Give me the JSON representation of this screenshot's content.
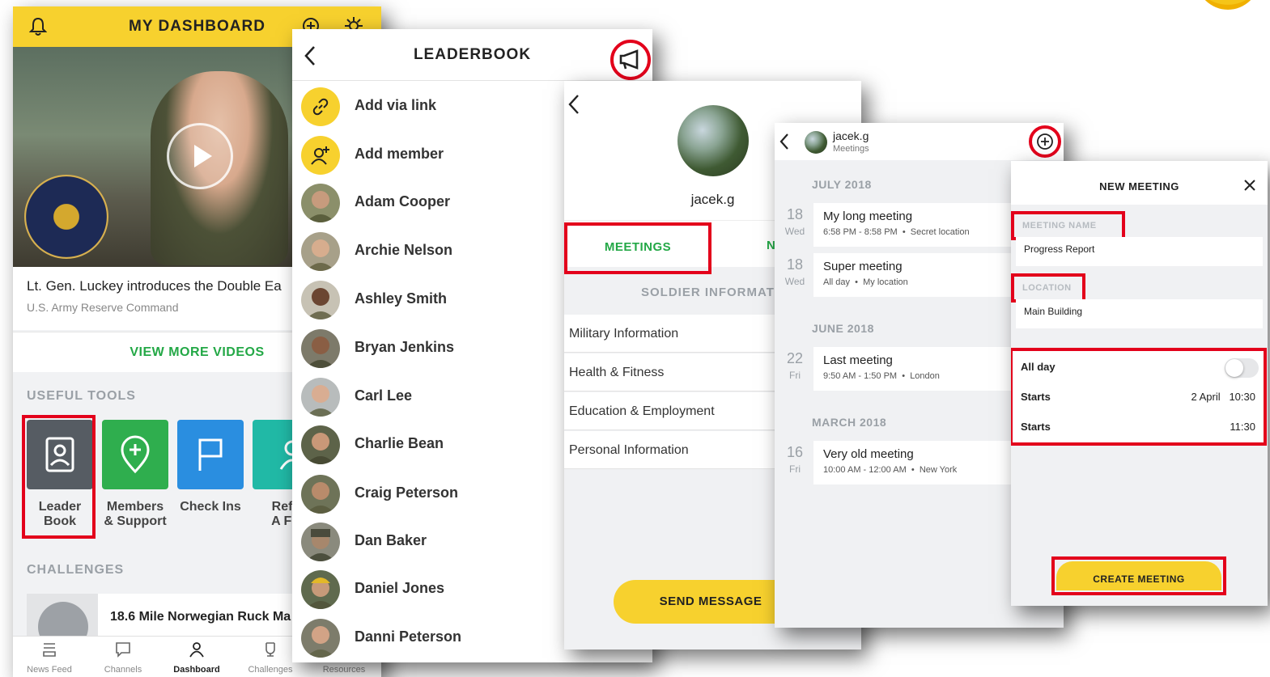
{
  "colors": {
    "yellow": "#f7d12e",
    "green": "#23a846",
    "highlight": "#e3001b"
  },
  "dashboard": {
    "title": "MY DASHBOARD",
    "video_title": "Lt. Gen. Luckey introduces the Double Ea",
    "video_source": "U.S. Army Reserve Command",
    "view_more": "VIEW MORE VIDEOS",
    "useful_tools_label": "USEFUL TOOLS",
    "tools": [
      {
        "line1": "Leader",
        "line2": "Book",
        "icon": "leaderbook-icon",
        "color": "#565c63"
      },
      {
        "line1": "Members",
        "line2": "& Support",
        "icon": "map-pin-plus-icon",
        "color": "#2fae4e"
      },
      {
        "line1": "Check Ins",
        "line2": "",
        "icon": "flag-icon",
        "color": "#2a8ee0"
      },
      {
        "line1": "Refe",
        "line2": "A Fri",
        "icon": "referral-icon",
        "color": "#21b9a6"
      }
    ],
    "challenges_label": "CHALLENGES",
    "challenge_title": "18.6 Mile Norwegian Ruck Ma",
    "nav": [
      {
        "label": "News Feed",
        "icon": "news-feed-icon"
      },
      {
        "label": "Channels",
        "icon": "channels-icon"
      },
      {
        "label": "Dashboard",
        "icon": "dashboard-icon"
      },
      {
        "label": "Challenges",
        "icon": "challenges-icon"
      },
      {
        "label": "Resources",
        "icon": "resources-icon"
      }
    ]
  },
  "leaderbook": {
    "title": "LEADERBOOK",
    "actions": [
      {
        "label": "Add via link",
        "icon": "link-icon"
      },
      {
        "label": "Add member",
        "icon": "add-person-icon"
      }
    ],
    "members": [
      "Adam Cooper",
      "Archie Nelson",
      "Ashley Smith",
      "Bryan Jenkins",
      "Carl Lee",
      "Charlie Bean",
      "Craig Peterson",
      "Dan Baker",
      "Daniel Jones",
      "Danni Peterson"
    ]
  },
  "profile": {
    "username": "jacek.g",
    "tab_meetings": "MEETINGS",
    "tab_next": "N",
    "section_title": "SOLDIER INFORMATIO",
    "items": [
      "Military Information",
      "Health & Fitness",
      "Education & Employment",
      "Personal Information"
    ],
    "send_message": "SEND MESSAGE"
  },
  "meetings": {
    "username": "jacek.g",
    "subtitle": "Meetings",
    "groups": [
      {
        "month": "JULY 2018",
        "items": [
          {
            "day": "18",
            "dow": "Wed",
            "name": "My long meeting",
            "time": "6:58 PM - 8:58 PM",
            "location": "Secret location"
          },
          {
            "day": "18",
            "dow": "Wed",
            "name": "Super meeting",
            "time": "All day",
            "location": "My location"
          }
        ]
      },
      {
        "month": "JUNE 2018",
        "items": [
          {
            "day": "22",
            "dow": "Fri",
            "name": "Last meeting",
            "time": "9:50 AM - 1:50 PM",
            "location": "London"
          }
        ]
      },
      {
        "month": "MARCH 2018",
        "items": [
          {
            "day": "16",
            "dow": "Fri",
            "name": "Very old meeting",
            "time": "10:00 AM - 12:00 AM",
            "location": "New York"
          }
        ]
      }
    ]
  },
  "new_meeting": {
    "title": "NEW MEETING",
    "name_label": "MEETING NAME",
    "name_value": "Progress Report",
    "location_label": "LOCATION",
    "location_value": "Main Building",
    "all_day_label": "All day",
    "all_day_on": false,
    "starts_label": "Starts",
    "starts_date": "2 April",
    "starts_time": "10:30",
    "ends_label": "Starts",
    "ends_time": "11:30",
    "create_label": "CREATE MEETING"
  }
}
